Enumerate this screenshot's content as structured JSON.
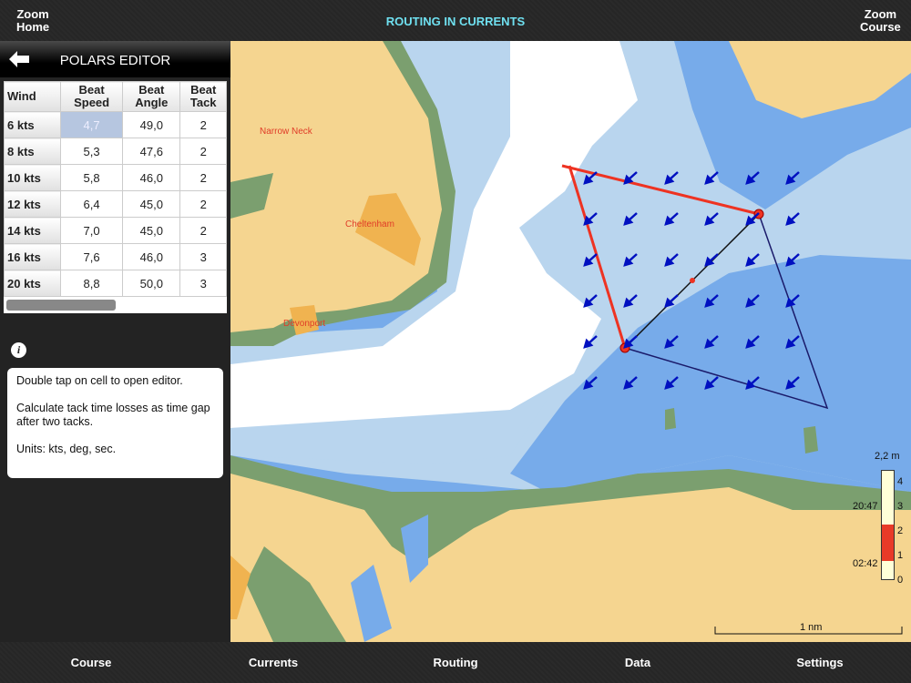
{
  "header": {
    "zoom_home": [
      "Zoom",
      "Home"
    ],
    "title": "ROUTING IN CURRENTS",
    "zoom_course": [
      "Zoom",
      "Course"
    ]
  },
  "sidebar": {
    "title": "POLARS EDITOR",
    "columns": [
      [
        "Wind"
      ],
      [
        "Beat",
        "Speed"
      ],
      [
        "Beat",
        "Angle"
      ],
      [
        "Beat",
        "Tack"
      ]
    ],
    "rows": [
      [
        "6 kts",
        "4,7",
        "49,0",
        "2"
      ],
      [
        "8 kts",
        "5,3",
        "47,6",
        "2"
      ],
      [
        "10 kts",
        "5,8",
        "46,0",
        "2"
      ],
      [
        "12 kts",
        "6,4",
        "45,0",
        "2"
      ],
      [
        "14 kts",
        "7,0",
        "45,0",
        "2"
      ],
      [
        "16 kts",
        "7,6",
        "46,0",
        "3"
      ],
      [
        "20 kts",
        "8,8",
        "50,0",
        "3"
      ]
    ],
    "selected_cell": "4,7",
    "info_icon": "i",
    "notes": [
      "Double tap on cell to open editor.",
      "Calculate tack time losses as time gap after two tacks.",
      "Units: kts, deg, sec."
    ]
  },
  "map": {
    "places": [
      "Narrow Neck",
      "Cheltenham",
      "Devonport"
    ],
    "scale": "1 nm",
    "tide": {
      "height": "2,2 m",
      "ticks": [
        "4",
        "3",
        "2",
        "1",
        "0"
      ],
      "high_time": "20:47",
      "low_time": "02:42",
      "level_m": 2.2
    },
    "colors": {
      "shallow": "#b9d5ee",
      "deep": "#77abea",
      "land": "#f5d590",
      "intertidal": "#7b9f6f",
      "route": "#ee3322",
      "course": "#1a1a6a"
    }
  },
  "tabs": [
    "Course",
    "Currents",
    "Routing",
    "Data",
    "Settings"
  ]
}
